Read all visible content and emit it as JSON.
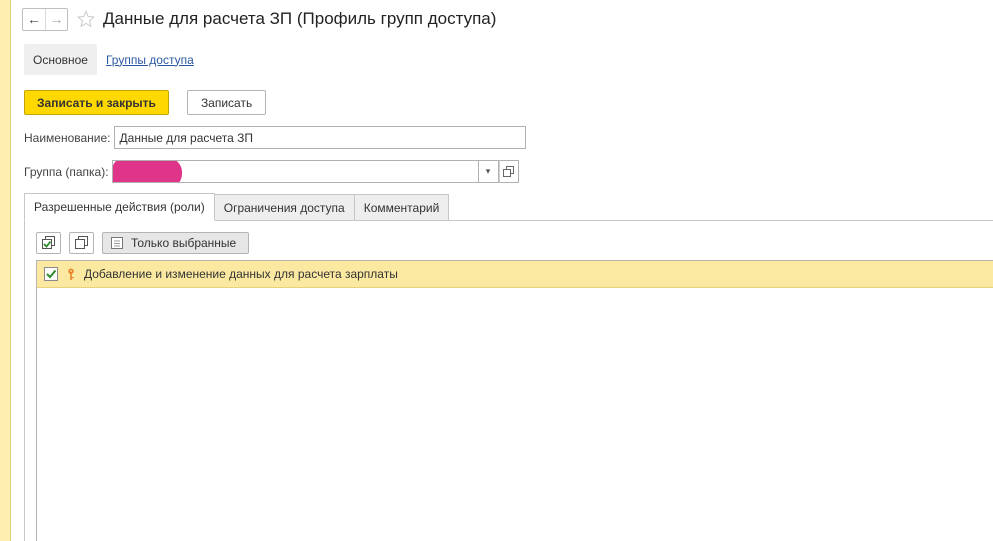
{
  "window": {
    "title": "Данные для расчета ЗП (Профиль групп доступа)",
    "nav_back_glyph": "←",
    "nav_forward_glyph": "→",
    "favorite_icon": "star-icon"
  },
  "section_tabs": [
    {
      "label": "Основное",
      "active": true
    },
    {
      "label": "Группы доступа",
      "active": false
    }
  ],
  "command_bar": {
    "save_and_close_label": "Записать и закрыть",
    "save_label": "Записать"
  },
  "form": {
    "name_label": "Наименование:",
    "name_value": "Данные для расчета ЗП",
    "group_label": "Группа (папка):",
    "group_value": "",
    "dropdown_glyph": "▾"
  },
  "page_tabs": [
    {
      "label": "Разрешенные действия (роли)",
      "active": true
    },
    {
      "label": "Ограничения доступа",
      "active": false
    },
    {
      "label": "Комментарий",
      "active": false
    }
  ],
  "roles_toolbar": {
    "check_all_icon": "check-all-icon",
    "uncheck_all_icon": "uncheck-all-icon",
    "only_selected_label": "Только выбранные"
  },
  "roles": [
    {
      "label": "Добавление и изменение данных для расчета зарплаты",
      "checked": true,
      "icon": "key-icon"
    }
  ],
  "colors": {
    "accent_yellow": "#ffd800",
    "selected_row": "#fbe9a2",
    "link": "#2c58a0",
    "redaction": "#e0348a"
  }
}
